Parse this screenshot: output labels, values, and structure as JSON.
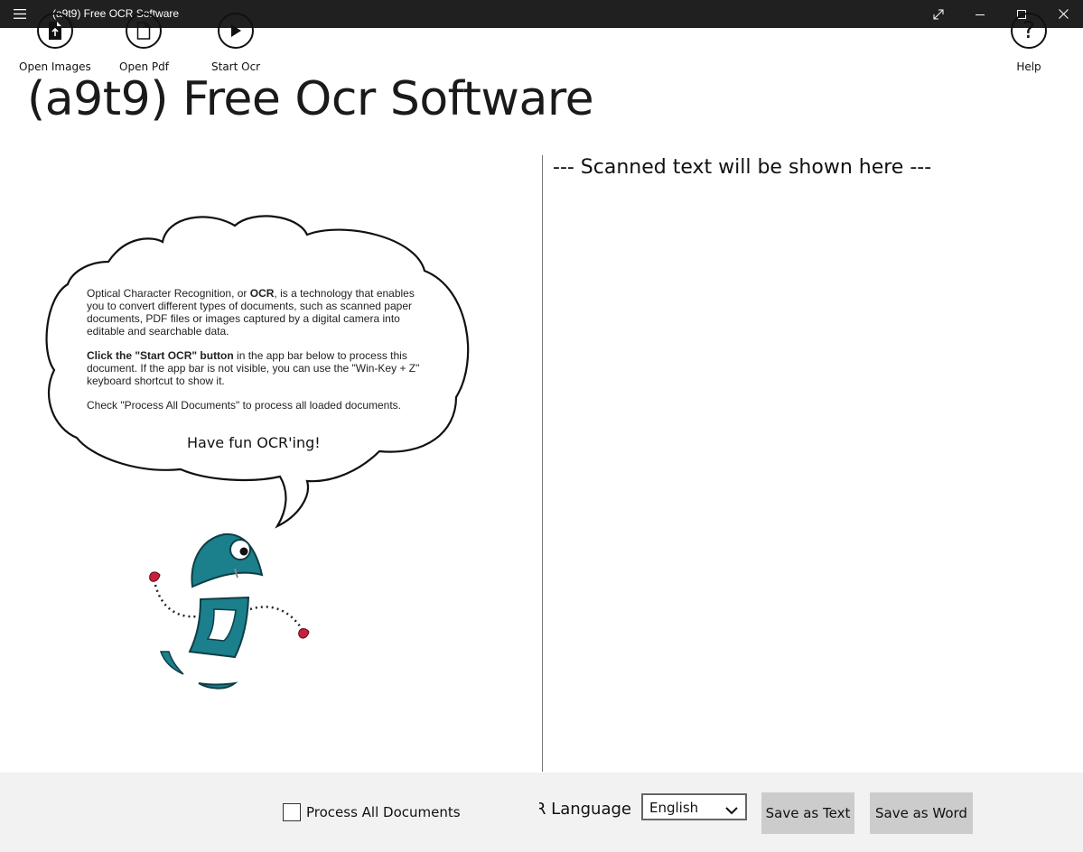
{
  "window": {
    "title": "(a9t9) Free OCR Software",
    "menu_icon": "hamburger-icon",
    "controls": [
      "expand-icon",
      "minimize-icon",
      "maximize-icon",
      "close-icon"
    ]
  },
  "app_title": "(a9t9) Free Ocr Software",
  "result_placeholder": "--- Scanned text will be shown here ---",
  "bubble": {
    "p1_a": "Optical Character Recognition, or ",
    "p1_b": "OCR",
    "p1_c": ", is a technology that enables you to convert different types of documents, such as scanned paper documents, PDF files or images captured by a digital camera into editable and searchable data.",
    "p2_a": "Click the \"Start OCR\" button",
    "p2_b": " in the app bar below to process this document. If the app bar is not visible, you can use the \"Win-Key + Z\" keyboard shortcut to show it.",
    "p3": "Check \"Process All Documents\" to process all loaded documents.",
    "fun": "Have fun OCR'ing!"
  },
  "appbar": {
    "open_images": "Open Images",
    "open_pdf": "Open Pdf",
    "start_ocr": "Start Ocr",
    "process_all": "Process All Documents",
    "process_all_checked": false,
    "ocr_language_label": "OCR Language",
    "ocr_language_value": "English",
    "save_text": "Save as Text",
    "save_word": "Save as Word",
    "help": "Help"
  },
  "colors": {
    "titlebar": "#202020",
    "appbar": "#f2f2f2",
    "button_gray": "#cccccc",
    "robot_teal": "#1b7f8c",
    "robot_red": "#c8203c"
  }
}
